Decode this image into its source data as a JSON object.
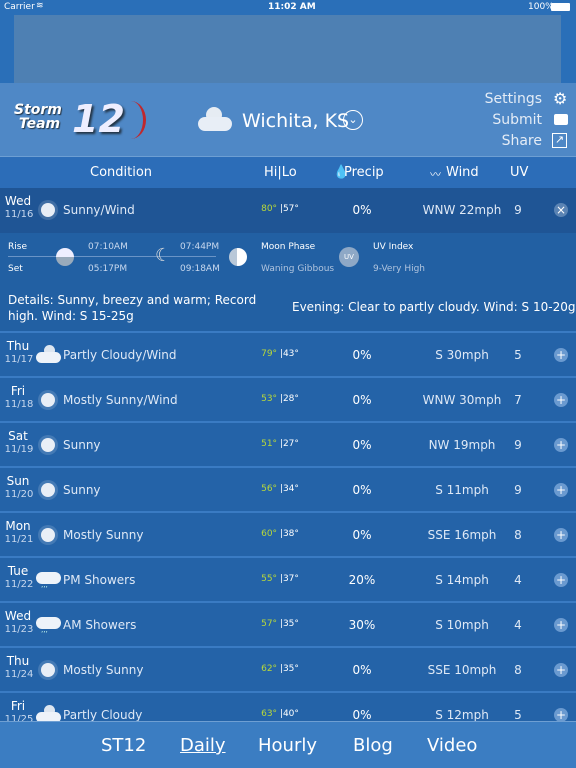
{
  "status": {
    "carrier": "Carrier",
    "time": "11:02 AM",
    "battery": "100%"
  },
  "header": {
    "logo_text": "Storm Team 12",
    "location": "Wichita, KS",
    "settings": "Settings",
    "submit": "Submit",
    "share": "Share"
  },
  "columns": {
    "condition": "Condition",
    "hilo": "Hi|Lo",
    "precip": "Precip",
    "wind": "Wind",
    "uv": "UV"
  },
  "expanded": {
    "day": "Wed",
    "date": "11/16",
    "icon": "sun-icon",
    "condition": "Sunny/Wind",
    "hi": "80°",
    "lo": "|57°",
    "precip": "0%",
    "wind": "WNW 22mph",
    "uv": "9",
    "rise_label": "Rise",
    "set_label": "Set",
    "sunrise": "07:10AM",
    "sunset": "05:17PM",
    "moonrise": "07:44PM",
    "moonset": "09:18AM",
    "moon_phase_label": "Moon Phase",
    "moon_phase": "Waning Gibbous",
    "uv_label": "UV Index",
    "uv_value": "9-Very High",
    "uv_icon_text": "UV",
    "details": "Details: Sunny, breezy and warm; Record high. Wind: S 15-25g",
    "evening": "Evening: Clear to partly cloudy. Wind: S 10-20g"
  },
  "rows": [
    {
      "day": "Thu",
      "date": "11/17",
      "icon": "partly-cloudy-icon",
      "condition": "Partly Cloudy/Wind",
      "hi": "79°",
      "lo": "|43°",
      "precip": "0%",
      "wind": "S 30mph",
      "uv": "5"
    },
    {
      "day": "Fri",
      "date": "11/18",
      "icon": "sun-icon",
      "condition": "Mostly Sunny/Wind",
      "hi": "53°",
      "lo": "|28°",
      "precip": "0%",
      "wind": "WNW 30mph",
      "uv": "7"
    },
    {
      "day": "Sat",
      "date": "11/19",
      "icon": "sun-icon",
      "condition": "Sunny",
      "hi": "51°",
      "lo": "|27°",
      "precip": "0%",
      "wind": "NW 19mph",
      "uv": "9"
    },
    {
      "day": "Sun",
      "date": "11/20",
      "icon": "sun-icon",
      "condition": "Sunny",
      "hi": "56°",
      "lo": "|34°",
      "precip": "0%",
      "wind": "S 11mph",
      "uv": "9"
    },
    {
      "day": "Mon",
      "date": "11/21",
      "icon": "sun-icon",
      "condition": "Mostly Sunny",
      "hi": "60°",
      "lo": "|38°",
      "precip": "0%",
      "wind": "SSE 16mph",
      "uv": "8"
    },
    {
      "day": "Tue",
      "date": "11/22",
      "icon": "showers-icon",
      "condition": "PM Showers",
      "hi": "55°",
      "lo": "|37°",
      "precip": "20%",
      "wind": "S 14mph",
      "uv": "4"
    },
    {
      "day": "Wed",
      "date": "11/23",
      "icon": "showers-icon",
      "condition": "AM Showers",
      "hi": "57°",
      "lo": "|35°",
      "precip": "30%",
      "wind": "S 10mph",
      "uv": "4"
    },
    {
      "day": "Thu",
      "date": "11/24",
      "icon": "sun-icon",
      "condition": "Mostly Sunny",
      "hi": "62°",
      "lo": "|35°",
      "precip": "0%",
      "wind": "SSE 10mph",
      "uv": "8"
    },
    {
      "day": "Fri",
      "date": "11/25",
      "icon": "partly-cloudy-icon",
      "condition": "Partly Cloudy",
      "hi": "63°",
      "lo": "|40°",
      "precip": "0%",
      "wind": "S 12mph",
      "uv": "5"
    }
  ],
  "nav": {
    "items": [
      "ST12",
      "Daily",
      "Hourly",
      "Blog",
      "Video"
    ],
    "active": "Daily"
  },
  "colors": {
    "hi_temp": "#b8d83a",
    "row_bg": "#2463a8",
    "header_bg": "#4f88c6"
  }
}
